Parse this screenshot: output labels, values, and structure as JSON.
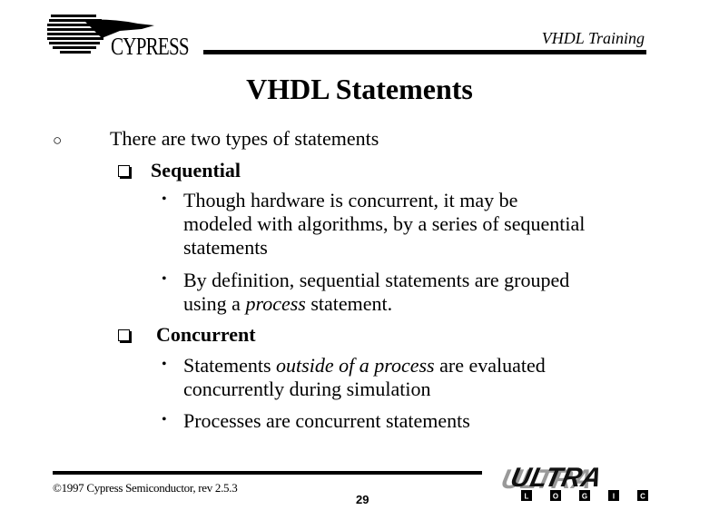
{
  "header": {
    "company_logo_text": "CYPRESS",
    "course_title": "VHDL Training"
  },
  "slide": {
    "title": "VHDL Statements",
    "main_bullet": "There are two types of statements",
    "sections": [
      {
        "heading": "Sequential",
        "items": [
          {
            "lines": [
              "Though hardware is concurrent, it may be",
              "modeled with algorithms, by a series of sequential",
              "statements"
            ]
          },
          {
            "line1": "By definition, sequential statements are grouped",
            "line2_pre": "using a ",
            "line2_italic": "process",
            "line2_post": " statement."
          }
        ]
      },
      {
        "heading": "Concurrent",
        "items": [
          {
            "line1_pre": "Statements ",
            "line1_italic": "outside of a process",
            "line1_post": " are evaluated",
            "line2": "concurrently during simulation"
          },
          {
            "line1": "Processes are concurrent statements"
          }
        ]
      }
    ]
  },
  "footer": {
    "copyright": "©1997 Cypress Semiconductor, rev 2.5.3",
    "page_number": "29",
    "brand_logo_text": "ULTRA",
    "brand_logo_subtext": [
      "L",
      "O",
      "G",
      "I",
      "C"
    ]
  }
}
